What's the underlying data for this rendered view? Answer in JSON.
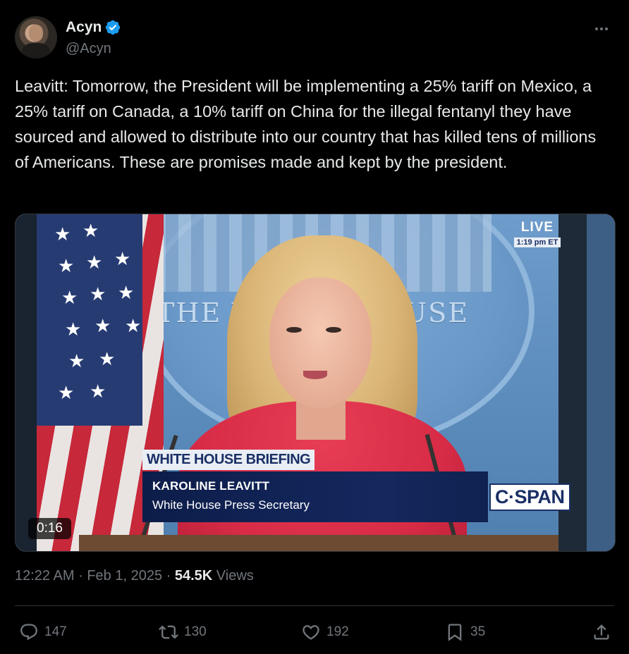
{
  "author": {
    "name": "Acyn",
    "handle": "@Acyn",
    "verified": true,
    "verified_color": "#1d9bf0"
  },
  "tweet": {
    "text": "Leavitt: Tomorrow, the President will be implementing a 25% tariff on Mexico, a 25% tariff on Canada, a 10% tariff on China for the illegal fentanyl they have sourced and allowed to distribute into our country that has killed tens of millions of Americans. These are promises made and kept by the president."
  },
  "video": {
    "duration": "0:16",
    "live_label": "LIVE",
    "live_time": "1:19 pm ET",
    "backdrop_text_left": "THE W",
    "backdrop_text_right": "OUSE",
    "lower_third_tag": "WHITE HOUSE BRIEFING",
    "lower_third_name": "KAROLINE LEAVITT",
    "lower_third_title": "White House Press Secretary",
    "network": "C·SPAN"
  },
  "meta": {
    "time": "12:22 AM",
    "separator": "·",
    "date": "Feb 1, 2025",
    "views_count": "54.5K",
    "views_label": "Views"
  },
  "actions": {
    "replies": "147",
    "reposts": "130",
    "likes": "192",
    "bookmarks": "35"
  },
  "icons": [
    "more-icon",
    "verified-icon",
    "reply-icon",
    "repost-icon",
    "like-icon",
    "bookmark-icon",
    "share-icon"
  ],
  "colors": {
    "background": "#000000",
    "text": "#e7e9ea",
    "muted": "#71767b",
    "accent": "#1d9bf0"
  }
}
